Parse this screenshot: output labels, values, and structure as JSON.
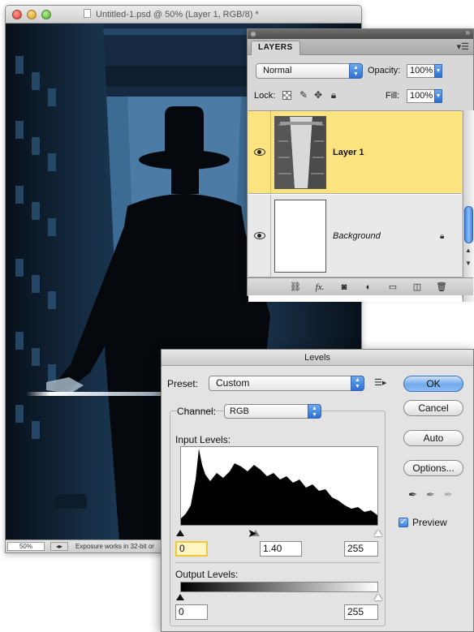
{
  "document_window": {
    "title": "Untitled-1.psd @ 50% (Layer 1, RGB/8) *",
    "zoom": "50%",
    "status_text": "Exposure works in 32-bit or",
    "status_arrow": "◂▸"
  },
  "layers_panel": {
    "tab_label": "LAYERS",
    "menu_icon": "panel-menu-icon",
    "collapse_icon": "»",
    "blend_mode": "Normal",
    "opacity_label": "Opacity:",
    "opacity_value": "100%",
    "lock_label": "Lock:",
    "fill_label": "Fill:",
    "fill_value": "100%",
    "layers": [
      {
        "name": "Layer 1",
        "selected": true,
        "visible": true
      },
      {
        "name": "Background",
        "selected": false,
        "visible": true,
        "locked": true
      }
    ],
    "footer_icons": [
      "link-icon",
      "fx-icon",
      "mask-icon",
      "adjustment-icon",
      "folder-icon",
      "new-layer-icon",
      "trash-icon"
    ],
    "fx_label": "fx."
  },
  "levels_dialog": {
    "title": "Levels",
    "preset_label": "Preset:",
    "preset_value": "Custom",
    "channel_label": "Channel:",
    "channel_value": "RGB",
    "input_levels_label": "Input Levels:",
    "input_black": "0",
    "input_gamma": "1.40",
    "input_white": "255",
    "output_levels_label": "Output Levels:",
    "output_black": "0",
    "output_white": "255",
    "buttons": {
      "ok": "OK",
      "cancel": "Cancel",
      "auto": "Auto",
      "options": "Options..."
    },
    "preview_label": "Preview",
    "preview_checked": true,
    "accent_color": "#3c7fe0",
    "selected_layer_color": "#fbe480"
  }
}
